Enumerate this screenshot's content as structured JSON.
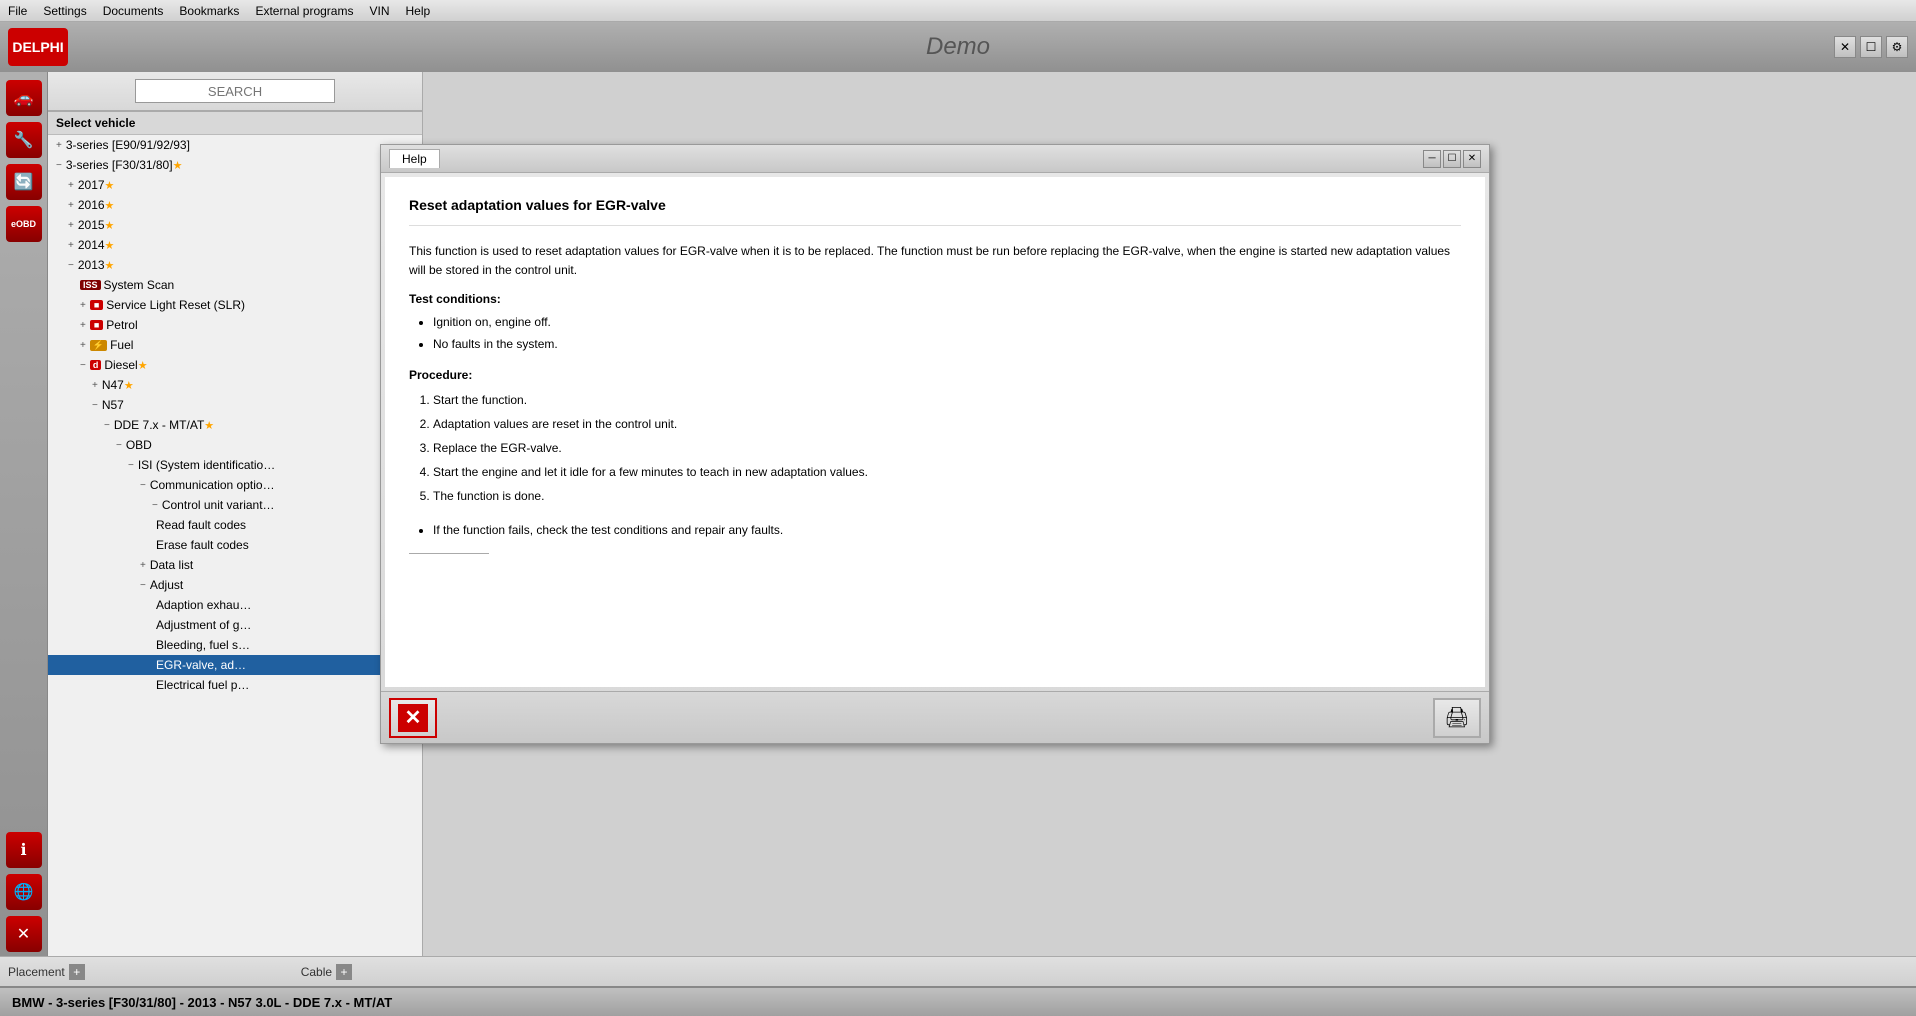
{
  "menu": {
    "items": [
      "File",
      "Settings",
      "Documents",
      "Bookmarks",
      "External programs",
      "VIN",
      "Help"
    ]
  },
  "titlebar": {
    "logo": "DELPHI",
    "title": "Demo",
    "close_icon": "✕",
    "maximize_icon": "☐",
    "restore_icon": "─"
  },
  "search": {
    "placeholder": "SEARCH"
  },
  "tree": {
    "header": "Select vehicle",
    "items": [
      {
        "id": "item1",
        "label": "3-series [E90/91/92/93]",
        "indent": 1,
        "icon": "+",
        "star": false,
        "selected": false
      },
      {
        "id": "item2",
        "label": "3-series [F30/31/80]",
        "indent": 1,
        "icon": "−",
        "star": true,
        "selected": false
      },
      {
        "id": "item3",
        "label": "2017",
        "indent": 2,
        "icon": "+",
        "star": true,
        "selected": false
      },
      {
        "id": "item4",
        "label": "2016",
        "indent": 2,
        "icon": "+",
        "star": true,
        "selected": false
      },
      {
        "id": "item5",
        "label": "2015",
        "indent": 2,
        "icon": "+",
        "star": true,
        "selected": false
      },
      {
        "id": "item6",
        "label": "2014",
        "indent": 2,
        "icon": "+",
        "star": true,
        "selected": false
      },
      {
        "id": "item7",
        "label": "2013",
        "indent": 2,
        "icon": "−",
        "star": true,
        "selected": false
      },
      {
        "id": "item8",
        "label": "System Scan",
        "indent": 3,
        "icon": "",
        "badge": "ISS",
        "badge_type": "iss",
        "star": false,
        "selected": false
      },
      {
        "id": "item9",
        "label": "Service Light Reset (SLR)",
        "indent": 3,
        "icon": "+",
        "badge": "red",
        "badge_type": "red",
        "star": false,
        "selected": false
      },
      {
        "id": "item10",
        "label": "Petrol",
        "indent": 3,
        "icon": "+",
        "badge": "p",
        "badge_type": "red",
        "star": false,
        "selected": false
      },
      {
        "id": "item11",
        "label": "Fuel",
        "indent": 3,
        "icon": "+",
        "badge": "f",
        "badge_type": "yellow",
        "star": false,
        "selected": false
      },
      {
        "id": "item12",
        "label": "Diesel",
        "indent": 3,
        "icon": "−",
        "badge": "d",
        "badge_type": "diesel",
        "star": true,
        "selected": false
      },
      {
        "id": "item13",
        "label": "N47",
        "indent": 4,
        "icon": "+",
        "star": true,
        "selected": false
      },
      {
        "id": "item14",
        "label": "N57",
        "indent": 4,
        "icon": "−",
        "star": false,
        "selected": false
      },
      {
        "id": "item15",
        "label": "DDE 7.x - MT/AT",
        "indent": 5,
        "icon": "−",
        "star": true,
        "selected": false
      },
      {
        "id": "item16",
        "label": "OBD",
        "indent": 6,
        "icon": "−",
        "star": false,
        "selected": false
      },
      {
        "id": "item17",
        "label": "ISI (System identificatio…",
        "indent": 7,
        "icon": "−",
        "star": false,
        "selected": false
      },
      {
        "id": "item18",
        "label": "Communication optio…",
        "indent": 8,
        "icon": "−",
        "star": false,
        "selected": false
      },
      {
        "id": "item19",
        "label": "Control unit variant…",
        "indent": 9,
        "icon": "−",
        "star": false,
        "selected": false
      },
      {
        "id": "item20",
        "label": "Read fault codes",
        "indent": 9,
        "icon": "—",
        "star": false,
        "selected": false
      },
      {
        "id": "item21",
        "label": "Erase fault codes",
        "indent": 9,
        "icon": "—",
        "star": false,
        "selected": false
      },
      {
        "id": "item22",
        "label": "Data list",
        "indent": 8,
        "icon": "+",
        "star": false,
        "selected": false
      },
      {
        "id": "item23",
        "label": "Adjust",
        "indent": 8,
        "icon": "−",
        "star": false,
        "selected": false
      },
      {
        "id": "item24",
        "label": "Adaption exhau…",
        "indent": 9,
        "icon": "—",
        "star": false,
        "selected": false
      },
      {
        "id": "item25",
        "label": "Adjustment of g…",
        "indent": 9,
        "icon": "—",
        "star": false,
        "selected": false
      },
      {
        "id": "item26",
        "label": "Bleeding, fuel s…",
        "indent": 9,
        "icon": "—",
        "star": false,
        "selected": false
      },
      {
        "id": "item27",
        "label": "EGR-valve, ad…",
        "indent": 9,
        "icon": "—",
        "star": false,
        "selected": true
      },
      {
        "id": "item28",
        "label": "Electrical fuel p…",
        "indent": 9,
        "icon": "—",
        "star": false,
        "selected": false
      }
    ]
  },
  "help_window": {
    "tab_label": "Help",
    "title": "Reset adaptation values for EGR-valve",
    "description": "This function is used to reset adaptation values for EGR-valve when it is to be replaced. The function must be run before replacing the EGR-valve, when the engine is started new adaptation values will be stored in the control unit.",
    "test_conditions_header": "Test conditions:",
    "test_conditions": [
      "Ignition on, engine off.",
      "No faults in the system."
    ],
    "procedure_header": "Procedure:",
    "procedure_steps": [
      "Start the function.",
      "Adaptation values are reset in the control unit.",
      "Replace the EGR-valve.",
      "Start the engine and let it idle for a few minutes to teach in new adaptation values.",
      "The function is done."
    ],
    "sub_bullet": "If the function fails, check the test conditions and repair any faults.",
    "close_label": "✕",
    "print_icon": "🖨"
  },
  "bottom_bar": {
    "placement_label": "Placement",
    "cable_label": "Cable"
  },
  "status_bar": {
    "text": "BMW - 3-series [F30/31/80] - 2013 - N57 3.0L - DDE 7.x - MT/AT"
  },
  "left_icons": {
    "icons": [
      "🚗",
      "🔧",
      "🔄",
      "eOBD",
      "ℹ",
      "🌐",
      "✕"
    ]
  }
}
